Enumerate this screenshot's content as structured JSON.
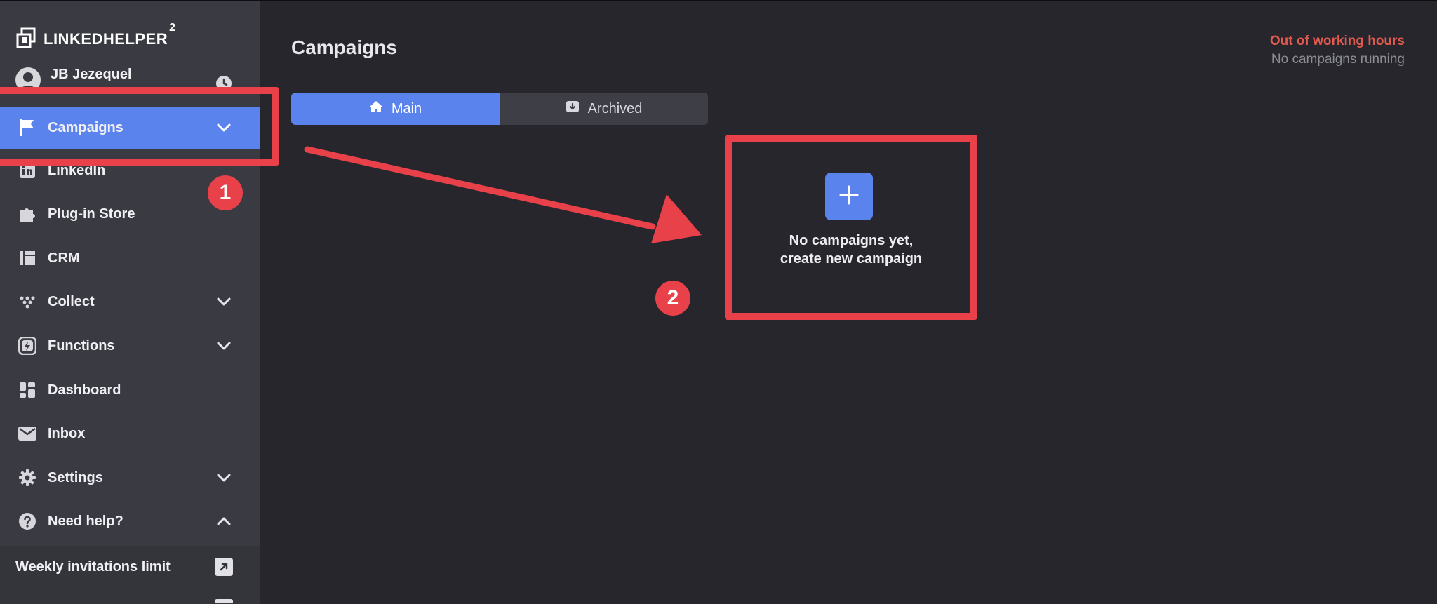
{
  "app": {
    "logo_text": "LINKEDHELPER",
    "logo_superscript": "2",
    "user_name": "JB Jezequel"
  },
  "sidebar": {
    "items": [
      {
        "label": "Campaigns",
        "icon": "flag-icon",
        "has_chevron": true,
        "active": true
      },
      {
        "label": "LinkedIn",
        "icon": "linkedin-icon"
      },
      {
        "label": "Plug-in Store",
        "icon": "puzzle-icon"
      },
      {
        "label": "CRM",
        "icon": "crm-icon"
      },
      {
        "label": "Collect",
        "icon": "collect-icon",
        "has_chevron": true
      },
      {
        "label": "Functions",
        "icon": "lightning-icon",
        "has_chevron": true
      },
      {
        "label": "Dashboard",
        "icon": "dashboard-icon"
      },
      {
        "label": "Inbox",
        "icon": "mail-icon"
      },
      {
        "label": "Settings",
        "icon": "gear-icon",
        "has_chevron": true
      },
      {
        "label": "Need help?",
        "icon": "help-icon",
        "has_chevron": true
      }
    ],
    "weekly_label": "Weekly invitations limit"
  },
  "header": {
    "title": "Campaigns",
    "status_warning": "Out of working hours",
    "status_text": "No campaigns running"
  },
  "tabs": [
    {
      "label": "Main",
      "icon": "home-icon",
      "active": true
    },
    {
      "label": "Archived",
      "icon": "archive-icon",
      "active": false
    }
  ],
  "empty_state": {
    "line1": "No campaigns yet,",
    "line2": "create new campaign"
  },
  "annotations": {
    "step1": "1",
    "step2": "2",
    "color": "#e8414a"
  },
  "colors": {
    "accent": "#5b83ee",
    "warning": "#e25a4f"
  }
}
